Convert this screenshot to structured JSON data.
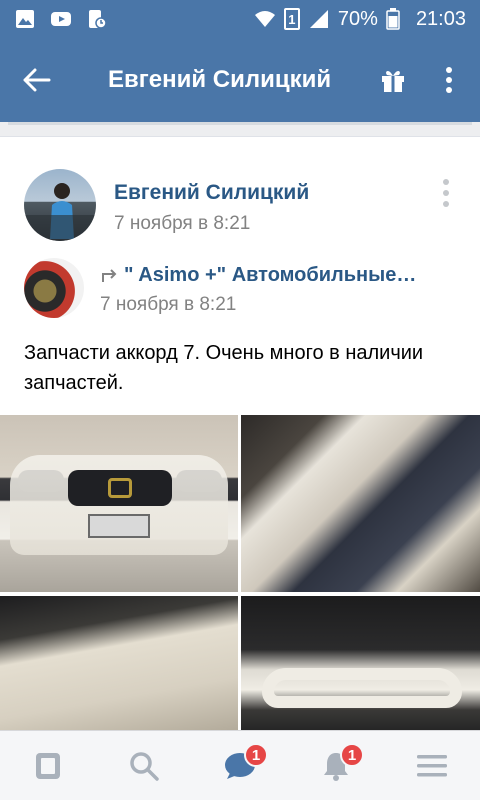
{
  "status_bar": {
    "battery_percent": "70%",
    "time": "21:03",
    "sim_label": "1"
  },
  "toolbar": {
    "title": "Евгений Силицкий"
  },
  "post": {
    "author": {
      "name": "Евгений Силицкий",
      "date": "7 ноября в 8:21"
    },
    "repost": {
      "name": "\" Asimo +\" Автомобильные…",
      "date": "7 ноября в 8:21"
    },
    "text": "Запчасти аккорд 7. Очень много в наличии запчастей."
  },
  "bottom_nav": {
    "messages_badge": "1",
    "notifications_badge": "1"
  },
  "colors": {
    "brand": "#4a76a8",
    "link": "#2a5885",
    "badge": "#e64646"
  }
}
